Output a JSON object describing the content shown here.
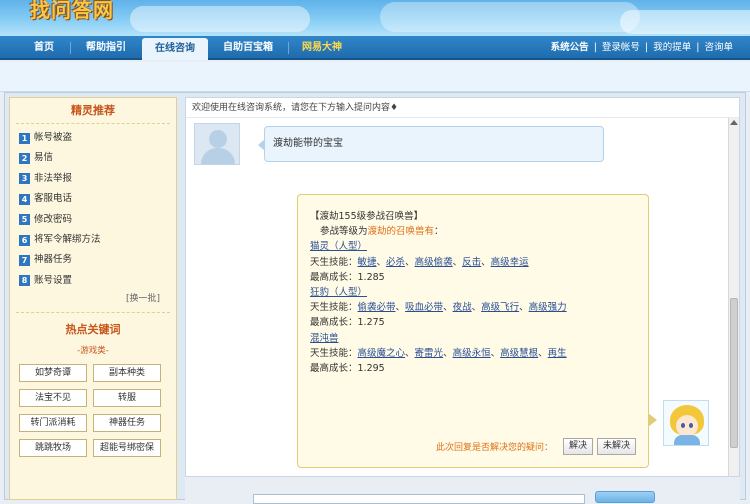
{
  "header": {
    "logo_text": "找问答网"
  },
  "nav": {
    "items": [
      {
        "label": "首页"
      },
      {
        "label": "帮助指引"
      },
      {
        "label": "在线咨询"
      },
      {
        "label": "自助百宝箱"
      },
      {
        "label": "网易大神"
      }
    ],
    "right": [
      "系统公告",
      "登录帐号",
      "我的提单",
      "咨询单"
    ]
  },
  "sidebar": {
    "title": "精灵推荐",
    "items": [
      {
        "num": "1",
        "label": "帐号被盗"
      },
      {
        "num": "2",
        "label": "易信"
      },
      {
        "num": "3",
        "label": "非法举报"
      },
      {
        "num": "4",
        "label": "客服电话"
      },
      {
        "num": "5",
        "label": "修改密码"
      },
      {
        "num": "6",
        "label": "将军令解绑方法"
      },
      {
        "num": "7",
        "label": "神器任务"
      },
      {
        "num": "8",
        "label": "账号设置"
      }
    ],
    "more": "[换一批]",
    "hot_title": "热点关键词",
    "hot_sub": "-游戏类-",
    "keywords": [
      "如梦奇谭",
      "副本种类",
      "法宝不见",
      "转服",
      "转门派消耗",
      "神器任务",
      "跳跳牧场",
      "超能号绑密保"
    ]
  },
  "chat": {
    "welcome": "欢迎使用在线咨询系统，请您在下方输入提问内容♦",
    "user_message": "渡劫能带的宝宝",
    "bot": {
      "title": "【渡劫155级参战召唤兽】",
      "intro_prefix": "参战等级为",
      "intro_highlight": "渡劫的召唤兽有",
      "intro_suffix": "：",
      "pets": [
        {
          "name": "猫灵（人型）",
          "skills_label": "天生技能：",
          "skills": [
            "敏捷",
            "必杀",
            "高级偷袭",
            "反击",
            "高级幸运"
          ],
          "growth_label": "最高成长：",
          "growth": "1.285"
        },
        {
          "name": "狂豹（人型）",
          "skills_label": "天生技能：",
          "skills": [
            "偷袭必带",
            "吸血必带",
            "夜战",
            "高级飞行",
            "高级强力"
          ],
          "growth_label": "最高成长：",
          "growth": "1.275"
        },
        {
          "name": "混沌兽",
          "skills_label": "天生技能：",
          "skills": [
            "高级魔之心",
            "寄雷光",
            "高级永恒",
            "高级慧根",
            "再生"
          ],
          "growth_label": "最高成长：",
          "growth": "1.295"
        }
      ],
      "feedback_question": "此次回复是否解决您的疑问：",
      "solved_label": "解决",
      "unsolved_label": "未解决"
    }
  }
}
